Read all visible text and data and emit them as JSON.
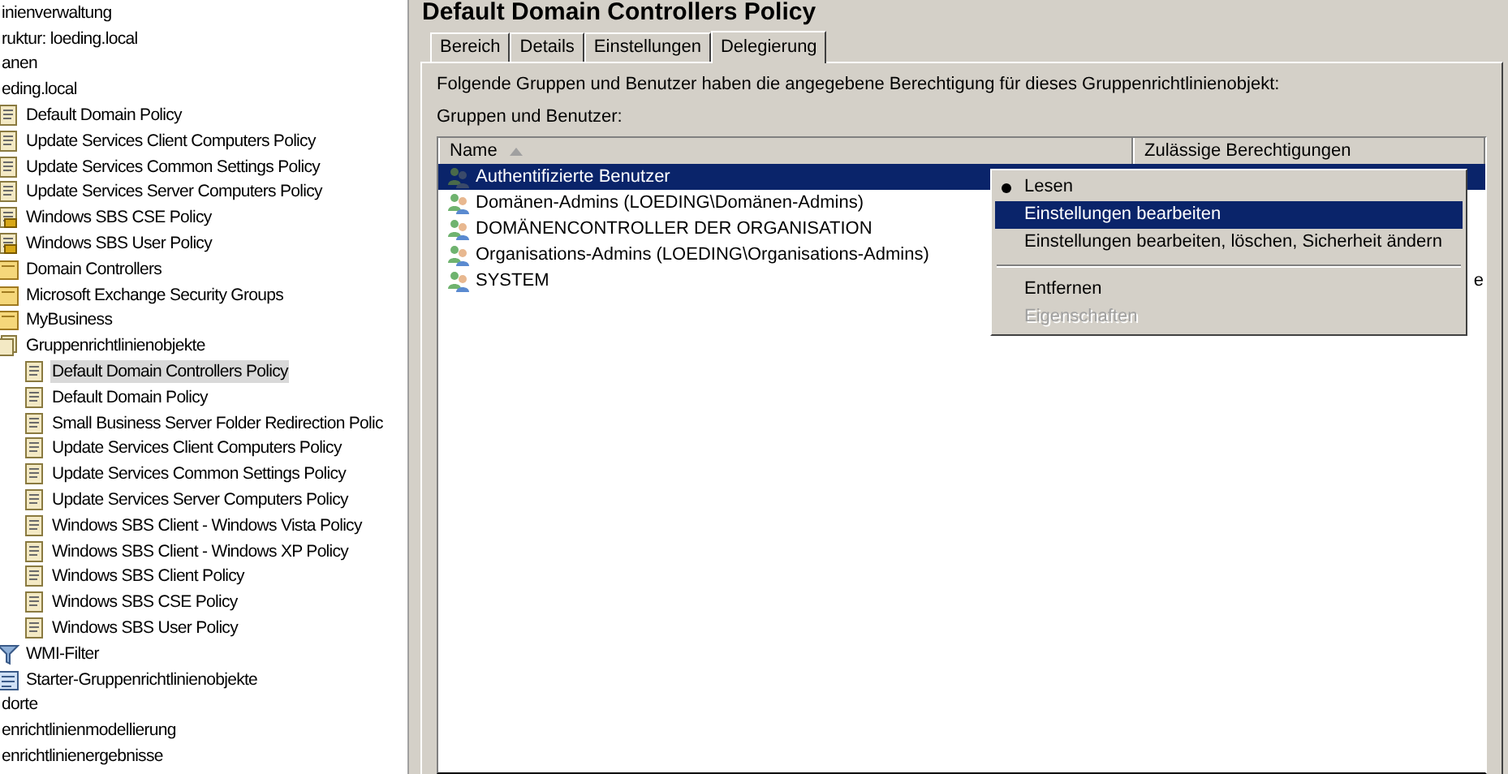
{
  "tree": [
    {
      "label": "inienverwaltung",
      "selected": false,
      "children": [
        {
          "label": "ruktur: loeding.local",
          "selected": false,
          "children": [
            {
              "label": "anen",
              "selected": false,
              "children": [
                {
                  "label": "eding.local",
                  "selected": false,
                  "children": [
                    {
                      "label": "Default Domain Policy",
                      "kind": "link",
                      "selected": false
                    },
                    {
                      "label": "Update Services Client Computers Policy",
                      "kind": "link",
                      "selected": false
                    },
                    {
                      "label": "Update Services Common Settings Policy",
                      "kind": "link",
                      "selected": false
                    },
                    {
                      "label": "Update Services Server Computers Policy",
                      "kind": "link",
                      "selected": false
                    },
                    {
                      "label": "Windows SBS CSE Policy",
                      "kind": "locked-link",
                      "selected": false
                    },
                    {
                      "label": "Windows SBS User Policy",
                      "kind": "locked-link",
                      "selected": false
                    },
                    {
                      "label": "Domain Controllers",
                      "kind": "ou",
                      "selected": false
                    },
                    {
                      "label": "Microsoft Exchange Security Groups",
                      "kind": "ou",
                      "selected": false
                    },
                    {
                      "label": "MyBusiness",
                      "kind": "ou",
                      "selected": false
                    },
                    {
                      "label": "Gruppenrichtlinienobjekte",
                      "kind": "gpo-folder",
                      "selected": false,
                      "children": [
                        {
                          "label": "Default Domain Controllers Policy",
                          "kind": "gpo",
                          "selected": true
                        },
                        {
                          "label": "Default Domain Policy",
                          "kind": "gpo",
                          "selected": false
                        },
                        {
                          "label": "Small Business Server Folder Redirection Polic",
                          "kind": "gpo",
                          "selected": false
                        },
                        {
                          "label": "Update Services Client Computers Policy",
                          "kind": "gpo",
                          "selected": false
                        },
                        {
                          "label": "Update Services Common Settings Policy",
                          "kind": "gpo",
                          "selected": false
                        },
                        {
                          "label": "Update Services Server Computers Policy",
                          "kind": "gpo",
                          "selected": false
                        },
                        {
                          "label": "Windows SBS Client - Windows Vista Policy",
                          "kind": "gpo",
                          "selected": false
                        },
                        {
                          "label": "Windows SBS Client - Windows XP Policy",
                          "kind": "gpo",
                          "selected": false
                        },
                        {
                          "label": "Windows SBS Client Policy",
                          "kind": "gpo",
                          "selected": false
                        },
                        {
                          "label": "Windows SBS CSE Policy",
                          "kind": "gpo",
                          "selected": false
                        },
                        {
                          "label": "Windows SBS User Policy",
                          "kind": "gpo",
                          "selected": false
                        }
                      ]
                    },
                    {
                      "label": "WMI-Filter",
                      "kind": "wmi",
                      "selected": false
                    },
                    {
                      "label": "Starter-Gruppenrichtlinienobjekte",
                      "kind": "starter",
                      "selected": false
                    }
                  ]
                }
              ]
            },
            {
              "label": "dorte",
              "selected": false
            }
          ]
        },
        {
          "label": "enrichtlinienmodellierung",
          "selected": false
        },
        {
          "label": "enrichtlinienergebnisse",
          "selected": false
        }
      ]
    }
  ],
  "title": "Default Domain Controllers Policy",
  "tabs": [
    {
      "label": "Bereich",
      "selected": false
    },
    {
      "label": "Details",
      "selected": false
    },
    {
      "label": "Einstellungen",
      "selected": false
    },
    {
      "label": "Delegierung",
      "selected": true
    }
  ],
  "intro": "Folgende Gruppen und Benutzer haben die angegebene Berechtigung für dieses Gruppenrichtlinienobjekt:",
  "list_label": "Gruppen und Benutzer:",
  "table": {
    "columns": [
      "Name",
      "Zulässige Berechtigungen"
    ],
    "rows": [
      {
        "name": "Authentifizierte Benutzer",
        "selected": true
      },
      {
        "name": "Domänen-Admins (LOEDING\\Domänen-Admins)",
        "selected": false
      },
      {
        "name": "DOMÄNENCONTROLLER DER ORGANISATION",
        "selected": false
      },
      {
        "name": "Organisations-Admins (LOEDING\\Organisations-Admins)",
        "selected": false
      },
      {
        "name": "SYSTEM",
        "selected": false,
        "permission": "e"
      }
    ]
  },
  "context_menu": [
    {
      "label": "Lesen",
      "selected": false,
      "checked": true,
      "disabled": false
    },
    {
      "label": "Einstellungen bearbeiten",
      "selected": true,
      "checked": false,
      "disabled": false
    },
    {
      "label": "Einstellungen bearbeiten, löschen, Sicherheit ändern",
      "selected": false,
      "checked": false,
      "disabled": false
    },
    {
      "kind": "separator"
    },
    {
      "label": "Entfernen",
      "selected": false,
      "checked": false,
      "disabled": false
    },
    {
      "label": "Eigenschaften",
      "selected": false,
      "checked": false,
      "disabled": true
    }
  ]
}
